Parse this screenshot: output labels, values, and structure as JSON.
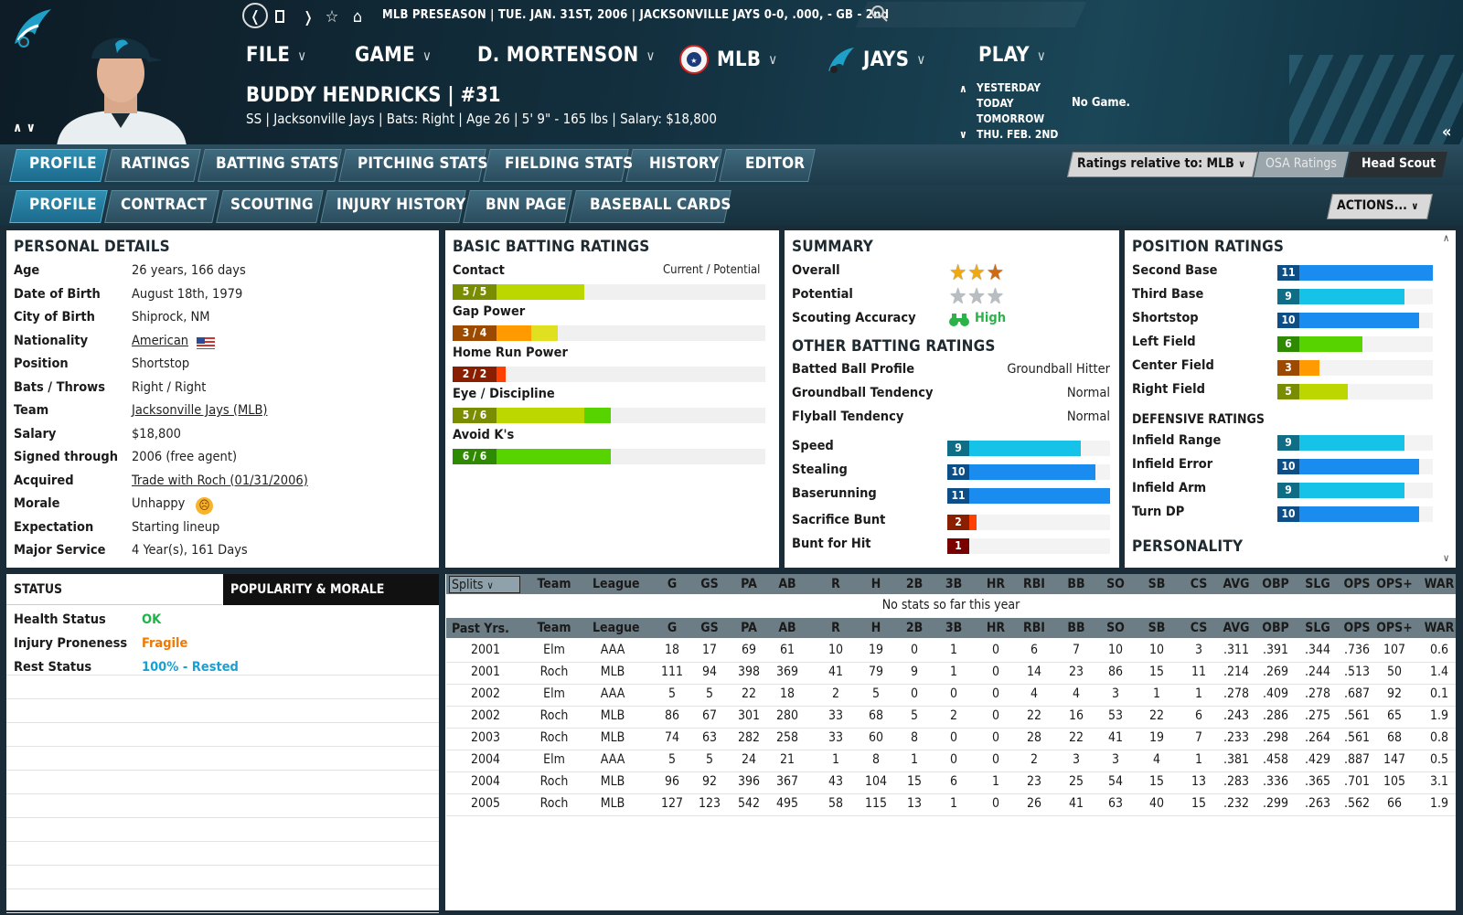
{
  "top": {
    "breadcrumb": "MLB PRESEASON  |  TUE. JAN. 31ST, 2006  |  JACKSONVILLE JAYS  0-0, .000, - GB - 2nd",
    "menus": [
      "FILE",
      "GAME",
      "D. MORTENSON",
      "MLB",
      "JAYS",
      "PLAY"
    ],
    "player_name": "BUDDY HENDRICKS  |  #31",
    "player_info": "SS | Jacksonville Jays  |  Bats: Right  |  Age 26  |  5' 9\" - 165 lbs  |  Salary: $18,800",
    "days": [
      "YESTERDAY",
      "TODAY",
      "TOMORROW",
      "THU. FEB. 2ND"
    ],
    "no_game": "No Game.",
    "colors": {
      "accent": "#1d6a8c",
      "header_bg": "#13303f"
    }
  },
  "tabs1": [
    "PROFILE",
    "RATINGS",
    "BATTING STATS",
    "PITCHING STATS",
    "FIELDING STATS",
    "HISTORY",
    "EDITOR"
  ],
  "tabs2": [
    "PROFILE",
    "CONTRACT",
    "SCOUTING",
    "INJURY HISTORY",
    "BNN PAGE",
    "BASEBALL CARDS"
  ],
  "ratings_relative": "Ratings relative to: MLB",
  "osa_ratings": "OSA Ratings",
  "head_scout": "Head Scout",
  "actions": "ACTIONS...",
  "personal": {
    "title": "PERSONAL DETAILS",
    "rows": [
      {
        "label": "Age",
        "value": "26 years, 166 days"
      },
      {
        "label": "Date of Birth",
        "value": "August 18th, 1979"
      },
      {
        "label": "City of Birth",
        "value": "Shiprock, NM"
      },
      {
        "label": "Nationality",
        "value": "American"
      },
      {
        "label": "Position",
        "value": "Shortstop"
      },
      {
        "label": "Bats / Throws",
        "value": "Right / Right"
      },
      {
        "label": "Team",
        "value": "Jacksonville Jays (MLB)"
      },
      {
        "label": "Salary",
        "value": "$18,800"
      },
      {
        "label": "Signed through",
        "value": "2006 (free agent)"
      },
      {
        "label": "Acquired",
        "value": "Trade with Roch (01/31/2006)"
      },
      {
        "label": "Morale",
        "value": "Unhappy"
      },
      {
        "label": "Expectation",
        "value": "Starting lineup"
      },
      {
        "label": "Major Service",
        "value": "4 Year(s), 161 Days"
      }
    ]
  },
  "batting": {
    "title": "BASIC BATTING RATINGS",
    "legend": "Current / Potential",
    "items": [
      {
        "label": "Contact",
        "tag": "5 / 5",
        "current": 5,
        "potential": 5,
        "color": "#bcd600",
        "tagcolor": "#7a8c00"
      },
      {
        "label": "Gap Power",
        "tag": "3 / 4",
        "current": 3,
        "potential": 4,
        "color": "#ff9a00",
        "potcolor": "#e0e020",
        "tagcolor": "#9c4a00"
      },
      {
        "label": "Home Run Power",
        "tag": "2 / 2",
        "current": 2,
        "potential": 2,
        "color": "#ff4000",
        "tagcolor": "#8a1e00"
      },
      {
        "label": "Eye / Discipline",
        "tag": "5 / 6",
        "current": 5,
        "potential": 6,
        "color": "#bcd600",
        "potcolor": "#57d400",
        "tagcolor": "#7a8c00"
      },
      {
        "label": "Avoid K's",
        "tag": "6 / 6",
        "current": 6,
        "potential": 6,
        "color": "#57d400",
        "tagcolor": "#2e8a00"
      }
    ]
  },
  "summary": {
    "title": "SUMMARY",
    "overall_label": "Overall",
    "overall_stars": 3,
    "potential_label": "Potential",
    "potential_stars": 3,
    "accuracy_label": "Scouting Accuracy",
    "accuracy_value": "High",
    "other_title": "OTHER BATTING RATINGS",
    "other": [
      {
        "label": "Batted Ball Profile",
        "value": "Groundball Hitter"
      },
      {
        "label": "Groundball Tendency",
        "value": "Normal"
      },
      {
        "label": "Flyball Tendency",
        "value": "Normal"
      }
    ],
    "bars": [
      {
        "label": "Speed",
        "value": 9,
        "tag": "9",
        "color": "#16c2e8",
        "tagcolor": "#0f6e86"
      },
      {
        "label": "Stealing",
        "value": 10,
        "tag": "10",
        "color": "#1a8cf0",
        "tagcolor": "#0d4e86"
      },
      {
        "label": "Baserunning",
        "value": 11,
        "tag": "11",
        "color": "#1a8cf0",
        "tagcolor": "#0d4e86"
      },
      {
        "label": "Sacrifice Bunt",
        "value": 2,
        "tag": "2",
        "color": "#ff4000",
        "tagcolor": "#8a1e00"
      },
      {
        "label": "Bunt for Hit",
        "value": 1,
        "tag": "1",
        "color": "#e01010",
        "tagcolor": "#7a0000"
      }
    ]
  },
  "positions": {
    "title": "POSITION RATINGS",
    "items": [
      {
        "label": "Second Base",
        "value": 11,
        "tag": "11",
        "color": "#1a8cf0",
        "tagcolor": "#0d4e86"
      },
      {
        "label": "Third Base",
        "value": 9,
        "tag": "9",
        "color": "#16c2e8",
        "tagcolor": "#0f6e86"
      },
      {
        "label": "Shortstop",
        "value": 10,
        "tag": "10",
        "color": "#1a8cf0",
        "tagcolor": "#0d4e86"
      },
      {
        "label": "Left Field",
        "value": 6,
        "tag": "6",
        "color": "#57d400",
        "tagcolor": "#2e8a00"
      },
      {
        "label": "Center Field",
        "value": 3,
        "tag": "3",
        "color": "#ff9a00",
        "tagcolor": "#9c4a00"
      },
      {
        "label": "Right Field",
        "value": 5,
        "tag": "5",
        "color": "#bcd600",
        "tagcolor": "#7a8c00"
      }
    ],
    "def_title": "DEFENSIVE RATINGS",
    "def": [
      {
        "label": "Infield Range",
        "value": 9,
        "tag": "9",
        "color": "#16c2e8",
        "tagcolor": "#0f6e86"
      },
      {
        "label": "Infield Error",
        "value": 10,
        "tag": "10",
        "color": "#1a8cf0",
        "tagcolor": "#0d4e86"
      },
      {
        "label": "Infield Arm",
        "value": 9,
        "tag": "9",
        "color": "#16c2e8",
        "tagcolor": "#0f6e86"
      },
      {
        "label": "Turn DP",
        "value": 10,
        "tag": "10",
        "color": "#1a8cf0",
        "tagcolor": "#0d4e86"
      }
    ],
    "personality_title": "PERSONALITY"
  },
  "status": {
    "tab1": "STATUS",
    "tab2": "POPULARITY & MORALE",
    "rows": [
      {
        "label": "Health Status",
        "value": "OK",
        "color": "#1fb34a"
      },
      {
        "label": "Injury Proneness",
        "value": "Fragile",
        "color": "#f07800"
      },
      {
        "label": "Rest Status",
        "value": "100% - Rested",
        "color": "#1aa0d0"
      }
    ]
  },
  "stats": {
    "splits": "Splits",
    "columns": [
      "Team",
      "League",
      "G",
      "GS",
      "PA",
      "AB",
      "R",
      "H",
      "2B",
      "3B",
      "HR",
      "RBI",
      "BB",
      "SO",
      "SB",
      "CS",
      "AVG",
      "OBP",
      "SLG",
      "OPS",
      "OPS+",
      "WAR"
    ],
    "no_stats": "No stats so far this year",
    "past_label": "Past Yrs.",
    "rows": [
      [
        "2001",
        "Elm",
        "AAA",
        "18",
        "17",
        "69",
        "61",
        "10",
        "19",
        "0",
        "1",
        "0",
        "6",
        "7",
        "10",
        "10",
        "3",
        ".311",
        ".391",
        ".344",
        ".736",
        "107",
        "0.6"
      ],
      [
        "2001",
        "Roch",
        "MLB",
        "111",
        "94",
        "398",
        "369",
        "41",
        "79",
        "9",
        "1",
        "0",
        "14",
        "23",
        "86",
        "15",
        "11",
        ".214",
        ".269",
        ".244",
        ".513",
        "50",
        "1.4"
      ],
      [
        "2002",
        "Elm",
        "AAA",
        "5",
        "5",
        "22",
        "18",
        "2",
        "5",
        "0",
        "0",
        "0",
        "4",
        "4",
        "3",
        "1",
        "1",
        ".278",
        ".409",
        ".278",
        ".687",
        "92",
        "0.1"
      ],
      [
        "2002",
        "Roch",
        "MLB",
        "86",
        "67",
        "301",
        "280",
        "33",
        "68",
        "5",
        "2",
        "0",
        "22",
        "16",
        "53",
        "22",
        "6",
        ".243",
        ".286",
        ".275",
        ".561",
        "65",
        "1.9"
      ],
      [
        "2003",
        "Roch",
        "MLB",
        "74",
        "63",
        "282",
        "258",
        "33",
        "60",
        "8",
        "0",
        "0",
        "28",
        "22",
        "41",
        "19",
        "7",
        ".233",
        ".298",
        ".264",
        ".561",
        "68",
        "0.8"
      ],
      [
        "2004",
        "Elm",
        "AAA",
        "5",
        "5",
        "24",
        "21",
        "1",
        "8",
        "1",
        "0",
        "0",
        "2",
        "3",
        "3",
        "4",
        "1",
        ".381",
        ".458",
        ".429",
        ".887",
        "147",
        "0.5"
      ],
      [
        "2004",
        "Roch",
        "MLB",
        "96",
        "92",
        "396",
        "367",
        "43",
        "104",
        "15",
        "6",
        "1",
        "23",
        "25",
        "54",
        "15",
        "13",
        ".283",
        ".336",
        ".365",
        ".701",
        "105",
        "3.1"
      ],
      [
        "2005",
        "Roch",
        "MLB",
        "127",
        "123",
        "542",
        "495",
        "58",
        "115",
        "13",
        "1",
        "0",
        "26",
        "41",
        "63",
        "40",
        "15",
        ".232",
        ".299",
        ".263",
        ".562",
        "66",
        "1.9"
      ]
    ]
  }
}
